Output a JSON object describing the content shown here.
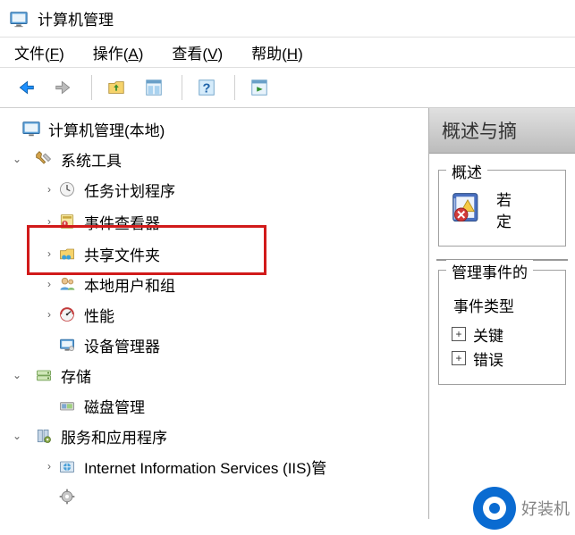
{
  "window": {
    "title": "计算机管理"
  },
  "menu": {
    "file": {
      "label": "文件",
      "accel": "F"
    },
    "action": {
      "label": "操作",
      "accel": "A"
    },
    "view": {
      "label": "查看",
      "accel": "V"
    },
    "help": {
      "label": "帮助",
      "accel": "H"
    }
  },
  "tree": {
    "root": {
      "label": "计算机管理(本地)"
    },
    "system": {
      "label": "系统工具"
    },
    "task": {
      "label": "任务计划程序"
    },
    "event": {
      "label": "事件查看器"
    },
    "shared": {
      "label": "共享文件夹"
    },
    "users": {
      "label": "本地用户和组"
    },
    "perf": {
      "label": "性能"
    },
    "devmgr": {
      "label": "设备管理器"
    },
    "storage": {
      "label": "存储"
    },
    "diskmgr": {
      "label": "磁盘管理"
    },
    "services": {
      "label": "服务和应用程序"
    },
    "iis": {
      "label": "Internet Information Services (IIS)管"
    }
  },
  "right": {
    "header": "概述与摘",
    "overview_group_title": "概述",
    "overview_line1": "若",
    "overview_line2": "定",
    "events_group_title": "管理事件的",
    "event_type_label": "事件类型",
    "event_type_items": [
      "关键",
      "错误"
    ]
  },
  "watermark": {
    "text": "好装机"
  }
}
